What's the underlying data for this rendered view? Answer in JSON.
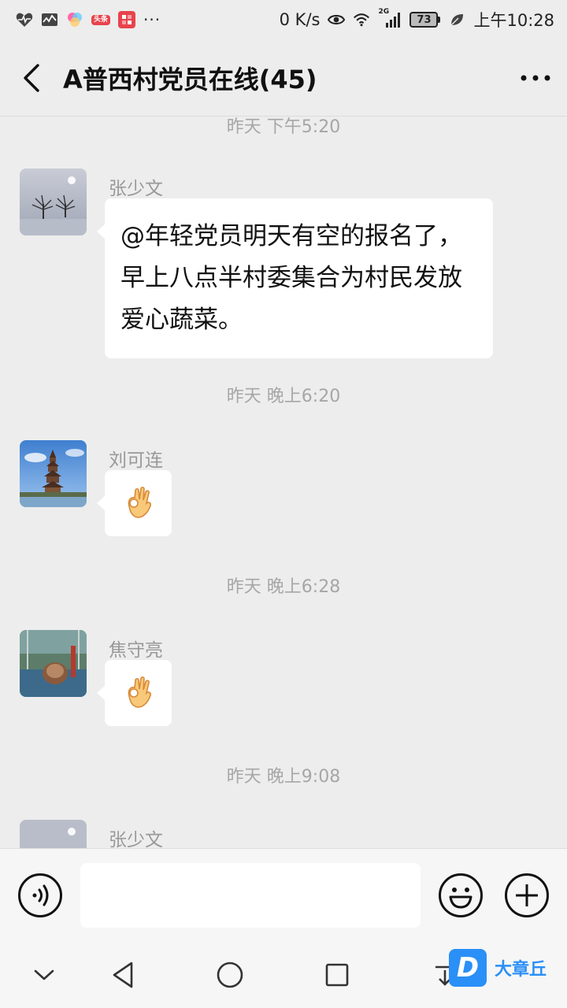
{
  "status_bar": {
    "app_badge": "头条",
    "more": "···",
    "net_speed": "0 K/s",
    "network_type": "2G",
    "battery": "73",
    "time": "上午10:28"
  },
  "header": {
    "title": "A普西村党员在线(45)"
  },
  "chat": {
    "messages": [
      {
        "time": "昨天 下午5:20",
        "sender": "张少文",
        "text": "@年轻党员明天有空的报名了，早上八点半村委集合为村民发放爱心蔬菜。"
      },
      {
        "time": "昨天 晚上6:20",
        "sender": "刘可连",
        "emoji": "ok-hand"
      },
      {
        "time": "昨天 晚上6:28",
        "sender": "焦守亮",
        "emoji": "ok-hand"
      },
      {
        "time": "昨天 晚上9:08",
        "sender": "张少文"
      }
    ]
  },
  "input": {
    "value": ""
  },
  "watermark": {
    "logo_letter": "D",
    "text": "大章丘"
  },
  "colors": {
    "background": "#ededed",
    "bubble": "#ffffff",
    "watermark": "#2a8ff7"
  }
}
